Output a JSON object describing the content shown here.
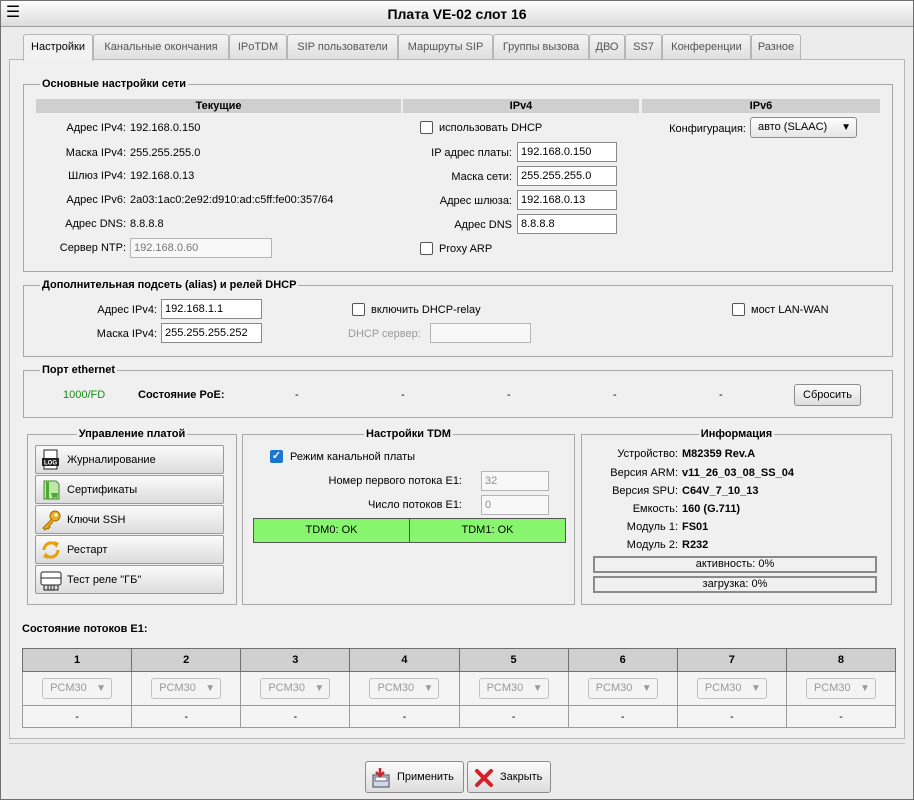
{
  "window": {
    "title": "Плата VE-02 слот 16"
  },
  "tabs": [
    "Настройки",
    "Канальные окончания",
    "IPoTDM",
    "SIP пользователи",
    "Маршруты SIP",
    "Группы вызова",
    "ДВО",
    "SS7",
    "Конференции",
    "Разное"
  ],
  "net": {
    "legend": "Основные настройки сети",
    "col_current": "Текущие",
    "col_ipv4": "IPv4",
    "col_ipv6": "IPv6",
    "cur_ipv4_label": "Адрес IPv4:",
    "cur_ipv4": "192.168.0.150",
    "cur_mask_label": "Маска IPv4:",
    "cur_mask": "255.255.255.0",
    "cur_gw_label": "Шлюз IPv4:",
    "cur_gw": "192.168.0.13",
    "cur_ipv6_label": "Адрес IPv6:",
    "cur_ipv6": "2a03:1ac0:2e92:d910:ad:c5ff:fe00:357/64",
    "cur_dns_label": "Адрес DNS:",
    "cur_dns": "8.8.8.8",
    "ntp_label": "Сервер NTP:",
    "ntp_placeholder": "192.168.0.60",
    "dhcp_label": "использовать DHCP",
    "ip_label": "IP адрес платы:",
    "ip": "192.168.0.150",
    "mask_label": "Маска сети:",
    "mask": "255.255.255.0",
    "gw_label": "Адрес шлюза:",
    "gw": "192.168.0.13",
    "dns_label": "Адрес DNS",
    "dns": "8.8.8.8",
    "proxy_arp_label": "Proxy ARP",
    "ipv6_conf_label": "Конфигурация:",
    "ipv6_conf": "авто (SLAAC)"
  },
  "alias": {
    "legend": "Дополнительная подсеть (alias) и релей DHCP",
    "ipv4_label": "Адрес IPv4:",
    "ipv4": "192.168.1.1",
    "mask_label": "Маска IPv4:",
    "mask": "255.255.255.252",
    "relay_label": "включить DHCP-relay",
    "dhcp_server_label": "DHCP сервер:",
    "bridge_label": "мост LAN-WAN"
  },
  "eth": {
    "legend": "Порт ethernet",
    "speed": "1000/FD",
    "poe_label": "Состояние PoE:",
    "poe": [
      "-",
      "-",
      "-",
      "-",
      "-"
    ],
    "reset": "Сбросить",
    "speed_color": "#1b8a1b"
  },
  "mgmt": {
    "legend": "Управление платой",
    "buttons": [
      "Журналирование",
      "Сертификаты",
      "Ключи SSH",
      "Рестарт",
      "Тест реле \"ГБ\""
    ]
  },
  "tdm": {
    "legend": "Настройки TDM",
    "channel_mode_label": "Режим канальной платы",
    "first_stream_label": "Номер первого потока E1:",
    "first_stream": "32",
    "streams_count_label": "Число потоков E1:",
    "streams_count": "0",
    "tdm0": "TDM0: OK",
    "tdm1": "TDM1: OK",
    "ok_color": "#88f56e"
  },
  "info": {
    "legend": "Информация",
    "rows": [
      {
        "label": "Устройство:",
        "value": "M82359 Rev.A"
      },
      {
        "label": "Версия ARM:",
        "value": "v11_26_03_08_SS_04"
      },
      {
        "label": "Версия SPU:",
        "value": "C64V_7_10_13"
      },
      {
        "label": "Емкость:",
        "value": "160 (G.711)"
      },
      {
        "label": "Модуль 1:",
        "value": "FS01"
      },
      {
        "label": "Модуль 2:",
        "value": "R232"
      }
    ],
    "activity": "активность: 0%",
    "load": "загрузка: 0%"
  },
  "streams": {
    "title": "Состояние потоков E1:",
    "cols": [
      "1",
      "2",
      "3",
      "4",
      "5",
      "6",
      "7",
      "8"
    ],
    "mode": "PCM30",
    "status": [
      "-",
      "-",
      "-",
      "-",
      "-",
      "-",
      "-",
      "-"
    ]
  },
  "footer": {
    "apply": "Применить",
    "close": "Закрыть"
  }
}
